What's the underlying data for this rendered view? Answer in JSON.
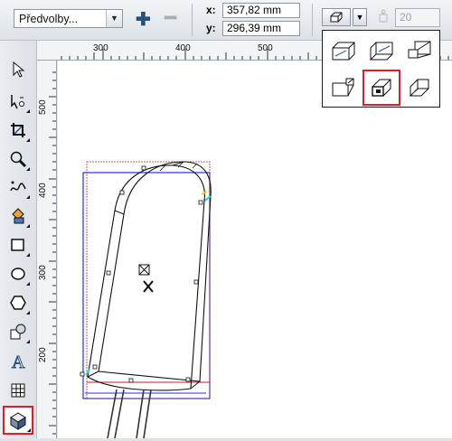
{
  "property_bar": {
    "preset_value": "Předvolby...",
    "x_label": "x:",
    "x_value": "357,82 mm",
    "y_label": "y:",
    "y_value": "296,39 mm",
    "depth_value": "20"
  },
  "rulers": {
    "horizontal": [
      "300",
      "400",
      "500"
    ],
    "vertical": [
      "500",
      "400",
      "300",
      "200"
    ]
  },
  "toolbox": {
    "tools": [
      "pick-tool",
      "shape-tool",
      "crop-tool",
      "zoom-tool",
      "freehand-tool",
      "smart-fill-tool",
      "rectangle-tool",
      "ellipse-tool",
      "polygon-tool",
      "basic-shapes-tool",
      "text-tool",
      "table-tool",
      "extrude-tool"
    ],
    "selected": "extrude-tool"
  },
  "extrusion_popup": {
    "types": [
      "small-back",
      "small-front",
      "big-back",
      "big-front",
      "back-parallel",
      "front-parallel"
    ],
    "selected": "back-parallel"
  },
  "colors": {
    "selection": "#e11c24",
    "accent": "#28527a"
  }
}
